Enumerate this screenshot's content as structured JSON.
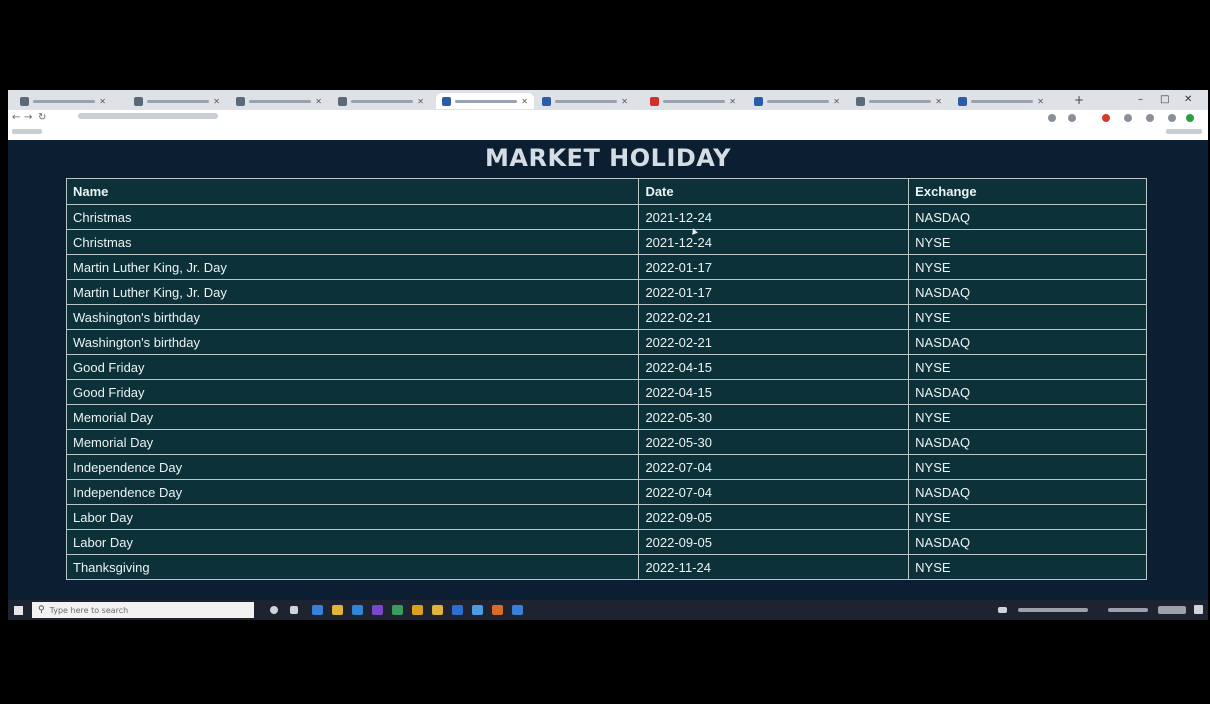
{
  "page": {
    "title": "MARKET HOLIDAY"
  },
  "table": {
    "headers": [
      "Name",
      "Date",
      "Exchange"
    ],
    "rows": [
      {
        "name": "Christmas",
        "date": "2021-12-24",
        "exchange": "NASDAQ"
      },
      {
        "name": "Christmas",
        "date": "2021-12-24",
        "exchange": "NYSE"
      },
      {
        "name": "Martin Luther King, Jr. Day",
        "date": "2022-01-17",
        "exchange": "NYSE"
      },
      {
        "name": "Martin Luther King, Jr. Day",
        "date": "2022-01-17",
        "exchange": "NASDAQ"
      },
      {
        "name": "Washington's birthday",
        "date": "2022-02-21",
        "exchange": "NYSE"
      },
      {
        "name": "Washington's birthday",
        "date": "2022-02-21",
        "exchange": "NASDAQ"
      },
      {
        "name": "Good Friday",
        "date": "2022-04-15",
        "exchange": "NYSE"
      },
      {
        "name": "Good Friday",
        "date": "2022-04-15",
        "exchange": "NASDAQ"
      },
      {
        "name": "Memorial Day",
        "date": "2022-05-30",
        "exchange": "NYSE"
      },
      {
        "name": "Memorial Day",
        "date": "2022-05-30",
        "exchange": "NASDAQ"
      },
      {
        "name": "Independence Day",
        "date": "2022-07-04",
        "exchange": "NYSE"
      },
      {
        "name": "Independence Day",
        "date": "2022-07-04",
        "exchange": "NASDAQ"
      },
      {
        "name": "Labor Day",
        "date": "2022-09-05",
        "exchange": "NYSE"
      },
      {
        "name": "Labor Day",
        "date": "2022-09-05",
        "exchange": "NASDAQ"
      },
      {
        "name": "Thanksgiving",
        "date": "2022-11-24",
        "exchange": "NYSE"
      }
    ]
  },
  "browser": {
    "tabs": [
      {
        "icon": "github-icon"
      },
      {
        "icon": "github-icon"
      },
      {
        "icon": "github-icon"
      },
      {
        "icon": "globe-icon"
      },
      {
        "icon": "page-icon",
        "active": true
      },
      {
        "icon": "page-icon"
      },
      {
        "icon": "youtube-icon"
      },
      {
        "icon": "page-icon"
      },
      {
        "icon": "globe-icon"
      },
      {
        "icon": "page-icon"
      }
    ],
    "new_tab_glyph": "+",
    "window_controls": [
      "–",
      "□",
      "✕"
    ]
  },
  "taskbar": {
    "search_placeholder": "Type here to search"
  },
  "colors": {
    "page_background": "#0c1e31",
    "table_background": "#0d3138",
    "table_border": "#b9c7c9",
    "title_text": "#d4dde4",
    "cell_text": "#ecf3f3",
    "taskbar": "#1d2330"
  }
}
